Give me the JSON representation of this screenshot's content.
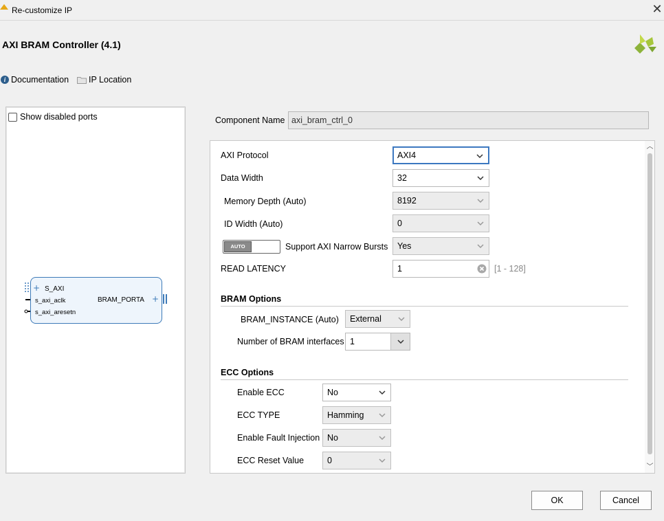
{
  "window": {
    "title": "Re-customize IP",
    "close_glyph": "✕"
  },
  "ip": {
    "title": "AXI BRAM Controller (4.1)"
  },
  "toolbar": {
    "documentation": "Documentation",
    "ip_location": "IP Location"
  },
  "symbol_panel": {
    "show_disabled_ports": "Show disabled ports",
    "show_disabled_checked": false,
    "ports_left": [
      "S_AXI",
      "s_axi_aclk",
      "s_axi_aresetn"
    ],
    "port_right": "BRAM_PORTA"
  },
  "component": {
    "label": "Component Name",
    "value": "axi_bram_ctrl_0"
  },
  "params": {
    "axi_protocol": {
      "label": "AXI Protocol",
      "value": "AXI4"
    },
    "data_width": {
      "label": "Data Width",
      "value": "32"
    },
    "memory_depth": {
      "label": "Memory Depth (Auto)",
      "value": "8192"
    },
    "id_width": {
      "label": "ID Width (Auto)",
      "value": "0"
    },
    "narrow_bursts": {
      "toggle": "AUTO",
      "label": "Support AXI Narrow Bursts",
      "value": "Yes"
    },
    "read_latency": {
      "label": "READ LATENCY",
      "value": "1",
      "range": "[1 - 128]"
    }
  },
  "bram_options": {
    "header": "BRAM Options",
    "instance": {
      "label": "BRAM_INSTANCE (Auto)",
      "value": "External"
    },
    "interfaces": {
      "label": "Number of BRAM interfaces",
      "value": "1"
    }
  },
  "ecc_options": {
    "header": "ECC Options",
    "enable_ecc": {
      "label": "Enable ECC",
      "value": "No"
    },
    "ecc_type": {
      "label": "ECC TYPE",
      "value": "Hamming"
    },
    "fault_injection": {
      "label": "Enable Fault Injection",
      "value": "No"
    },
    "reset_value": {
      "label": "ECC Reset Value",
      "value": "0"
    }
  },
  "buttons": {
    "ok": "OK",
    "cancel": "Cancel"
  },
  "colors": {
    "accent": "#3c78c0",
    "block_border": "#3d7ab8",
    "logo": "#8db33a"
  }
}
